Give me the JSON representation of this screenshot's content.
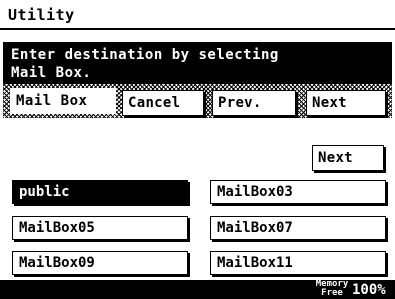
{
  "title": "Utility",
  "message": {
    "line1": "Enter destination by selecting",
    "line2": "Mail Box."
  },
  "tabs": {
    "mailbox_label": "Mail Box"
  },
  "toolbar": {
    "cancel_label": "Cancel",
    "prev_label": "Prev.",
    "next_label": "Next"
  },
  "page_next_label": "Next",
  "mailboxes": [
    {
      "label": "public",
      "selected": true
    },
    {
      "label": "MailBox03",
      "selected": false
    },
    {
      "label": "MailBox05",
      "selected": false
    },
    {
      "label": "MailBox07",
      "selected": false
    },
    {
      "label": "MailBox09",
      "selected": false
    },
    {
      "label": "MailBox11",
      "selected": false
    }
  ],
  "status": {
    "memory_line1": "Memory",
    "memory_line2": "Free",
    "memory_value": "100%"
  }
}
